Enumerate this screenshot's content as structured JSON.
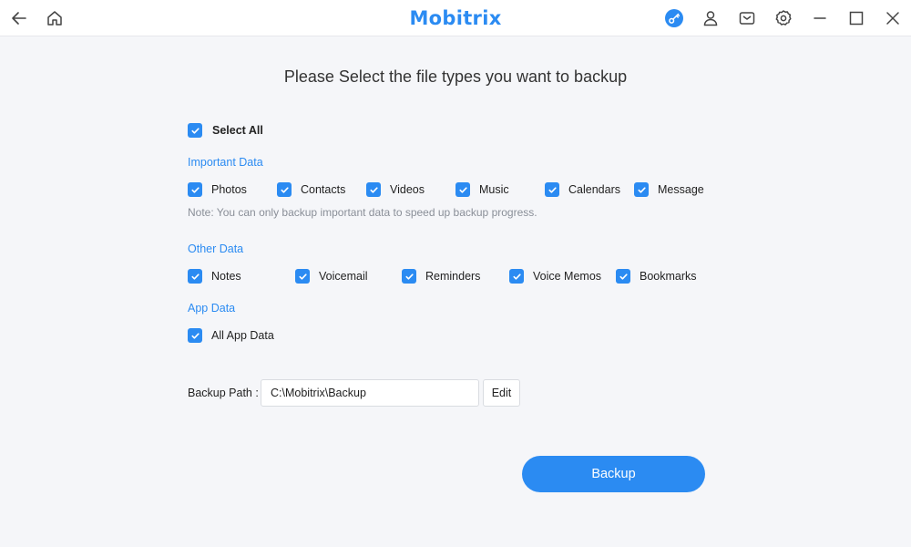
{
  "titlebar": {
    "app_name": "Mobitrix",
    "brand_color": "#2b8bf2",
    "left_icons": [
      "back-arrow-icon",
      "home-icon"
    ],
    "right_icons": [
      "key-icon",
      "user-icon",
      "mail-icon",
      "gear-icon",
      "minimize-icon",
      "maximize-icon",
      "close-icon"
    ]
  },
  "main": {
    "heading": "Please Select the file types you want to backup",
    "select_all": {
      "label": "Select All",
      "checked": true
    },
    "important_data": {
      "title": "Important Data",
      "items": [
        {
          "label": "Photos",
          "checked": true
        },
        {
          "label": "Contacts",
          "checked": true
        },
        {
          "label": "Videos",
          "checked": true
        },
        {
          "label": "Music",
          "checked": true
        },
        {
          "label": "Calendars",
          "checked": true
        },
        {
          "label": "Message",
          "checked": true
        }
      ],
      "note": "Note: You can only backup important data to speed up backup progress."
    },
    "other_data": {
      "title": "Other Data",
      "items": [
        {
          "label": "Notes",
          "checked": true
        },
        {
          "label": "Voicemail",
          "checked": true
        },
        {
          "label": "Reminders",
          "checked": true
        },
        {
          "label": "Voice Memos",
          "checked": true
        },
        {
          "label": "Bookmarks",
          "checked": true
        }
      ]
    },
    "app_data": {
      "title": "App Data",
      "items": [
        {
          "label": "All App Data",
          "checked": true
        }
      ]
    },
    "backup_path": {
      "label": "Backup Path :",
      "value": "C:\\Mobitrix\\Backup",
      "edit_label": "Edit"
    },
    "backup_button": "Backup"
  }
}
